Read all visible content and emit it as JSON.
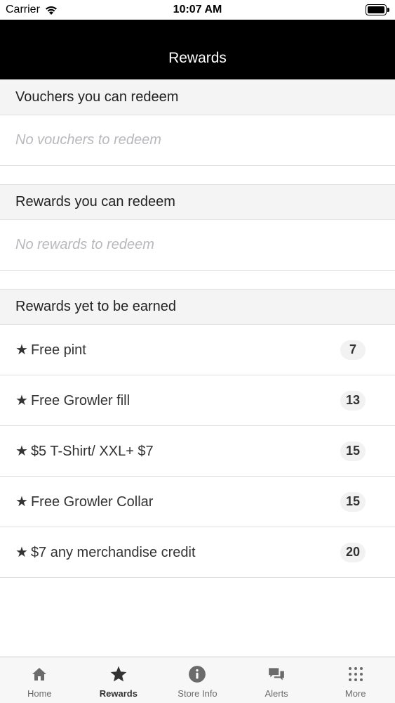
{
  "status_bar": {
    "carrier": "Carrier",
    "time": "10:07 AM"
  },
  "nav": {
    "title": "Rewards"
  },
  "sections": {
    "vouchers": {
      "title": "Vouchers you can redeem",
      "empty_text": "No vouchers to redeem"
    },
    "rewards_redeem": {
      "title": "Rewards you can redeem",
      "empty_text": "No rewards to redeem"
    },
    "rewards_earn": {
      "title": "Rewards yet to be earned",
      "items": [
        {
          "star": "★",
          "name": "Free pint",
          "points": "7"
        },
        {
          "star": "★",
          "name": "Free Growler fill",
          "points": "13"
        },
        {
          "star": "★",
          "name": "$5 T-Shirt/ XXL+ $7",
          "points": "15"
        },
        {
          "star": "★",
          "name": "Free Growler Collar",
          "points": "15"
        },
        {
          "star": "★",
          "name": "$7 any merchandise credit",
          "points": "20"
        }
      ]
    }
  },
  "tab_bar": {
    "tabs": [
      {
        "label": "Home",
        "icon": "home-icon"
      },
      {
        "label": "Rewards",
        "icon": "star-icon",
        "active": true
      },
      {
        "label": "Store Info",
        "icon": "info-icon"
      },
      {
        "label": "Alerts",
        "icon": "chat-bubbles-icon"
      },
      {
        "label": "More",
        "icon": "grid-dots-icon"
      }
    ]
  },
  "colors": {
    "nav_background": "#000000",
    "tab_icon_inactive": "#6b6b6b",
    "tab_icon_active": "#333333",
    "placeholder_text": "#b8b8bd"
  }
}
